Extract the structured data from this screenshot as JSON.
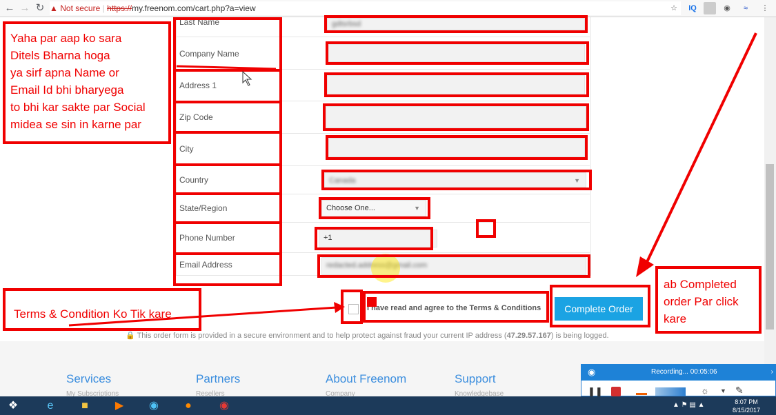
{
  "browser": {
    "not_secure": "Not secure",
    "url_scheme": "https://",
    "url_rest": "my.freenom.com/cart.php?a=view",
    "ext_iq": "IQ"
  },
  "form": {
    "labels": {
      "last_name": "Last Name",
      "company_name": "Company Name",
      "address1": "Address 1",
      "zip_code": "Zip Code",
      "city": "City",
      "country": "Country",
      "state_region": "State/Region",
      "phone_number": "Phone Number",
      "email_address": "Email Address"
    },
    "values": {
      "last_name": "gdtsrbsd",
      "country": "Canada",
      "state_region": "Choose One...",
      "phone_prefix": "+1",
      "email": "redacted.address@gmail.com"
    },
    "terms_text": "I have read and agree to the Terms & Conditions",
    "complete_order": "Complete Order",
    "secure_notice_prefix": "This order form is provided in a secure environment and to help protect against fraud your current IP address (",
    "ip": "47.29.57.167",
    "secure_notice_suffix": ") is being logged."
  },
  "annotations": {
    "details_note": [
      "Yaha par aap ko sara",
      "Ditels Bharna hoga",
      "ya sirf apna Name or",
      "Email Id bhi bharyega",
      "to bhi kar sakte par Social",
      "midea se sin in karne par"
    ],
    "terms_note": "Terms & Condition Ko Tik kare",
    "order_note": [
      "ab Completed",
      "order Par click",
      "kare"
    ]
  },
  "footer": {
    "headings": [
      "Services",
      "Partners",
      "About Freenom",
      "Support"
    ],
    "subs": [
      "My Subscriptions",
      "Resellers",
      "Company",
      "Knowledgebase"
    ]
  },
  "recorder": {
    "status": "Recording... 00:05:06"
  },
  "taskbar": {
    "time": "8:07 PM",
    "date": "8/15/2017"
  },
  "colors": {
    "annotation_red": "#f00000",
    "button_blue": "#1ba3e3",
    "link_blue": "#3a8dde"
  }
}
